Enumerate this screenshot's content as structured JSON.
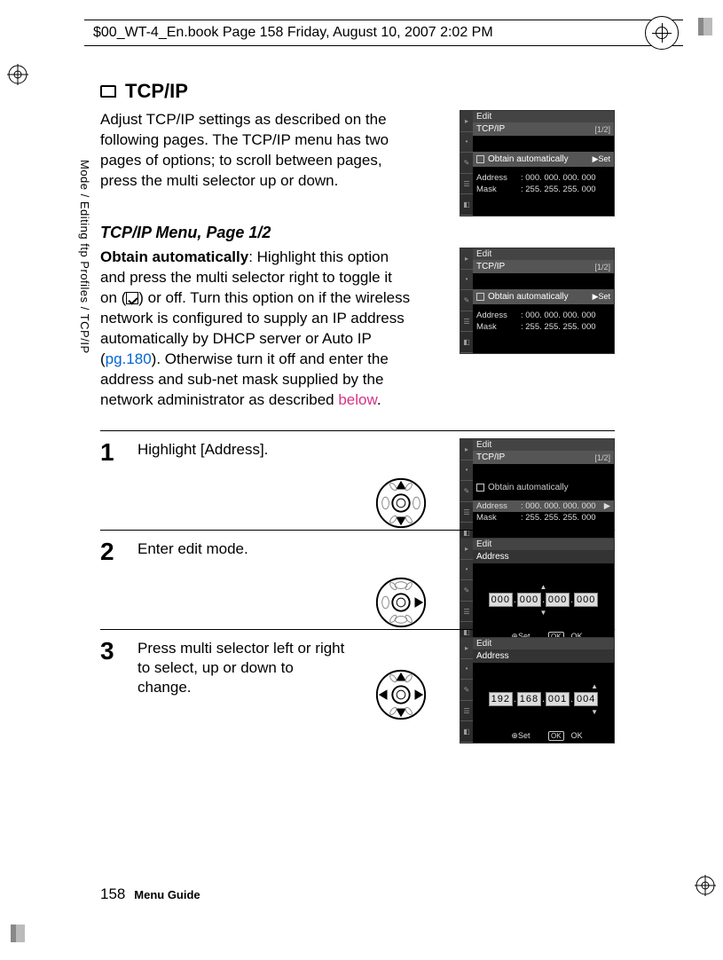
{
  "header": "$00_WT-4_En.book  Page 158  Friday, August 10, 2007  2:02 PM",
  "sidebar": "Mode / Editing ftp Profiles / TCP/IP",
  "title": "TCP/IP",
  "intro": "Adjust TCP/IP settings as described on the following pages.  The TCP/IP menu has two pages of options; to scroll between pages, press the multi selector up or down.",
  "subhead": "TCP/IP Menu, Page 1/2",
  "obtain": {
    "label": "Obtain automatically",
    "t1": ": Highlight this option and press the multi selector right to toggle it on (",
    "t2": ") or off.  Turn this option on if the wireless network is configured to supply an IP address automatically by DHCP server or Auto IP (",
    "link": "pg.180",
    "t3": ").  Otherwise turn it off and enter the address and sub-net mask supplied by the network administrator as described ",
    "below": "below",
    "t4": "."
  },
  "steps": [
    {
      "n": "1",
      "text": "Highlight [Address]."
    },
    {
      "n": "2",
      "text": "Enter edit mode."
    },
    {
      "n": "3",
      "text": "Press multi selector left or right to select, up or down to change."
    }
  ],
  "shot": {
    "edit": "Edit",
    "tcpip": "TCP/IP",
    "page": "[1/2]",
    "obtain": "Obtain automatically",
    "set": "▶Set",
    "address_k": "Address",
    "mask_k": "Mask",
    "address_v": ": 000. 000. 000. 000",
    "mask_v": ": 255. 255. 255. 000",
    "addr_title": "Address",
    "ip0": [
      "000",
      "000",
      "000",
      "000"
    ],
    "ip3": [
      "192",
      "168",
      "001",
      "004"
    ],
    "foot_set": "⊕Set",
    "foot_ok": "OK",
    "foot_ok2": "OK"
  },
  "footer": {
    "page": "158",
    "label": "Menu Guide"
  }
}
